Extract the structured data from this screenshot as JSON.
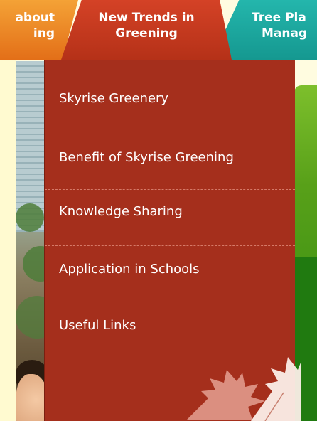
{
  "tabs": [
    {
      "line1": "about",
      "line2": "ing"
    },
    {
      "line1": "New Trends in",
      "line2": "Greening"
    },
    {
      "line1": "Tree Pla",
      "line2": "Manag"
    }
  ],
  "menu": {
    "items": [
      {
        "label": "Skyrise Greenery"
      },
      {
        "label": "Benefit of Skyrise Greening"
      },
      {
        "label": "Knowledge Sharing"
      },
      {
        "label": "Application in Schools"
      },
      {
        "label": "Useful Links"
      }
    ]
  },
  "colors": {
    "menu_bg": "#a52f1c",
    "tab_active": "#c23a20",
    "tab_orange": "#e97a1e",
    "tab_teal": "#1aa59d",
    "panel_green": "#58a019",
    "page_bg": "#fffce0"
  },
  "icons": {
    "decoration": "maple-leaf-icon"
  }
}
